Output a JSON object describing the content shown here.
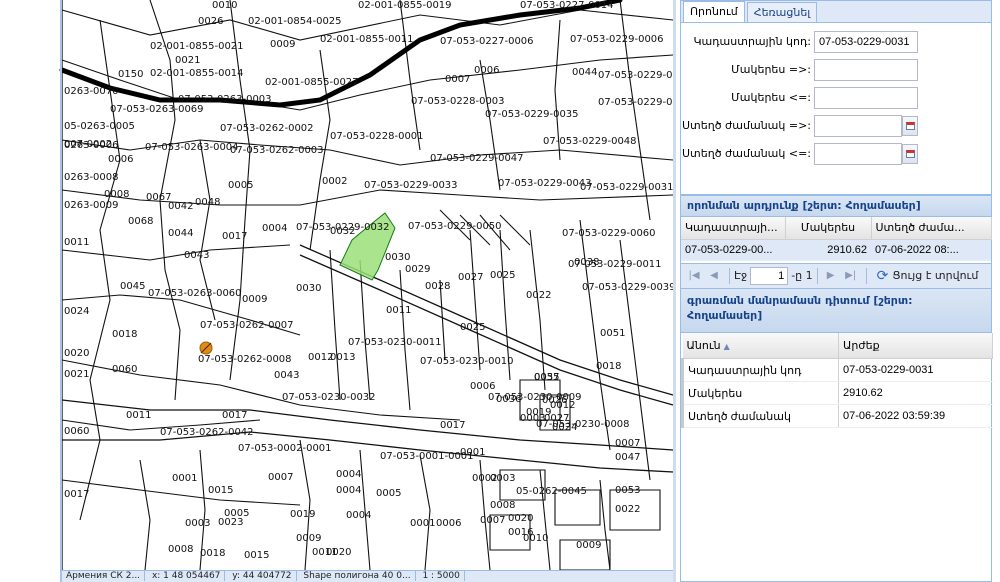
{
  "map": {
    "parcel_labels": [
      {
        "text": "0026"
      },
      {
        "text": "0010"
      },
      {
        "text": "02-001-0854-0025"
      },
      {
        "text": "02-001-0855-0019"
      },
      {
        "text": "07-053-0227-0014"
      },
      {
        "text": "02-001-0855-0021"
      },
      {
        "text": "0009"
      },
      {
        "text": "02-001-0855-0011"
      },
      {
        "text": "07-053-0227-0006"
      },
      {
        "text": "07-053-0229-0006"
      },
      {
        "text": "0021"
      },
      {
        "text": "0044"
      },
      {
        "text": "07-053-0229-0007"
      },
      {
        "text": "0150"
      },
      {
        "text": "02-001-0855-0014"
      },
      {
        "text": "02-001-0855-0027"
      },
      {
        "text": "0007"
      },
      {
        "text": "07-053-0229-0009"
      },
      {
        "text": "0006"
      },
      {
        "text": "0263-0070"
      },
      {
        "text": "07-053-0263-0003"
      },
      {
        "text": "07-053-0228-0003"
      },
      {
        "text": "07-053-0263-0069"
      },
      {
        "text": "07-053-0229-0035"
      },
      {
        "text": "05-0263-0005"
      },
      {
        "text": "07-053-0262-0002"
      },
      {
        "text": "07-053-0228-0001"
      },
      {
        "text": "07-053-0229-0048"
      },
      {
        "text": "007-0002"
      },
      {
        "text": "0263-0006"
      },
      {
        "text": "07-053-0263-0004"
      },
      {
        "text": "07-053-0262-0003"
      },
      {
        "text": "0006"
      },
      {
        "text": "07-053-0229-0047"
      },
      {
        "text": "07-053-0229-0043"
      },
      {
        "text": "0263-0008"
      },
      {
        "text": "0002"
      },
      {
        "text": "07-053-0229-0033"
      },
      {
        "text": "0005"
      },
      {
        "text": "0008"
      },
      {
        "text": "0067"
      },
      {
        "text": "0048"
      },
      {
        "text": "07-053-0229-0031"
      },
      {
        "text": "0263-0009"
      },
      {
        "text": "0068"
      },
      {
        "text": "0042"
      },
      {
        "text": "0004"
      },
      {
        "text": "07-053-0229-0032"
      },
      {
        "text": "07-053-0229-0050"
      },
      {
        "text": "0032"
      },
      {
        "text": "07-053-0229-0060"
      },
      {
        "text": "0011"
      },
      {
        "text": "0044"
      },
      {
        "text": "0017"
      },
      {
        "text": "0043"
      },
      {
        "text": "0030"
      },
      {
        "text": "0029"
      },
      {
        "text": "0027"
      },
      {
        "text": "0025"
      },
      {
        "text": "0038"
      },
      {
        "text": "07-053-0229-0011"
      },
      {
        "text": "0022"
      },
      {
        "text": "07-053-0263-0060"
      },
      {
        "text": "0028"
      },
      {
        "text": "0030"
      },
      {
        "text": "07-053-0229-0039"
      },
      {
        "text": "0045"
      },
      {
        "text": "0009"
      },
      {
        "text": "0011"
      },
      {
        "text": "0024"
      },
      {
        "text": "0018"
      },
      {
        "text": "07-053-0262-0007"
      },
      {
        "text": "0025"
      },
      {
        "text": "0051"
      },
      {
        "text": "07-053-0230-0011"
      },
      {
        "text": "0020"
      },
      {
        "text": "0060"
      },
      {
        "text": "07-053-0262-0008"
      },
      {
        "text": "0013"
      },
      {
        "text": "0012"
      },
      {
        "text": "07-053-0230-0010"
      },
      {
        "text": "0018"
      },
      {
        "text": "0021"
      },
      {
        "text": "0043"
      },
      {
        "text": "0055"
      },
      {
        "text": "0006"
      },
      {
        "text": "07-053-0230-0032"
      },
      {
        "text": "0036"
      },
      {
        "text": "07-053-0230-0009"
      },
      {
        "text": "0011"
      },
      {
        "text": "0017"
      },
      {
        "text": "07-053-0230-0008"
      },
      {
        "text": "07-053-0262-0042"
      },
      {
        "text": "0017"
      },
      {
        "text": "07-053-0002-0001"
      },
      {
        "text": "0007"
      },
      {
        "text": "07-053-0001-0001"
      },
      {
        "text": "0060"
      },
      {
        "text": "0004"
      },
      {
        "text": "0003"
      },
      {
        "text": "0001"
      },
      {
        "text": "0001"
      },
      {
        "text": "0002"
      },
      {
        "text": "0004"
      },
      {
        "text": "0015"
      },
      {
        "text": "0007"
      },
      {
        "text": "0005"
      },
      {
        "text": "05-0262-0045"
      },
      {
        "text": "0017"
      },
      {
        "text": "0005"
      },
      {
        "text": "0008"
      },
      {
        "text": "0023"
      },
      {
        "text": "0019"
      },
      {
        "text": "0003"
      },
      {
        "text": "0008"
      },
      {
        "text": "0004"
      },
      {
        "text": "0001"
      },
      {
        "text": "0006"
      },
      {
        "text": "0007"
      },
      {
        "text": "0020"
      },
      {
        "text": "0016"
      },
      {
        "text": "0010"
      },
      {
        "text": "0009"
      },
      {
        "text": "0011"
      },
      {
        "text": "0020"
      },
      {
        "text": "0018"
      },
      {
        "text": "0015"
      },
      {
        "text": "0009"
      },
      {
        "text": "0022"
      },
      {
        "text": "0053"
      },
      {
        "text": "0047"
      },
      {
        "text": "0037"
      },
      {
        "text": "0012"
      },
      {
        "text": "0026"
      },
      {
        "text": "0019"
      },
      {
        "text": "0027"
      },
      {
        "text": "0003"
      },
      {
        "text": "0024"
      }
    ],
    "selected_parcel_color": "#9be07a",
    "status_bar": [
      "Армения СК 2...",
      "x: 1 48 054467",
      "y: 44 404772",
      "Shape полигона 40 0...",
      "1 : 5000"
    ]
  },
  "panel": {
    "tabs": [
      {
        "label": "Որոնում",
        "active": true
      },
      {
        "label": "Հեռացնել",
        "active": false
      }
    ],
    "search": {
      "cadastral_code_label": "Կադաստրային կոդ:",
      "cadastral_code_value": "07-053-0229-0031",
      "area_min_label": "Մակերես =>:",
      "area_min_value": "",
      "area_max_label": "Մակերես <=:",
      "area_max_value": "",
      "created_from_label": "Ստեղծ ժամանակ =>:",
      "created_from_value": "",
      "created_to_label": "Ստեղծ ժամանակ <=:",
      "created_to_value": ""
    },
    "results": {
      "title": "որոնման արդյունք [շերտ: Հողամասեր]",
      "columns": [
        "Կադաստրայի...",
        "Մակերես",
        "Ստեղծ ժամա..."
      ],
      "rows": [
        {
          "code": "07-053-0229-00...",
          "area": "2910.62",
          "created": "07-06-2022 08:..."
        }
      ]
    },
    "pager": {
      "page_label": "Էջ",
      "page_value": "1",
      "of_label": "-ը 1",
      "refresh_label": "Ցույց է տրվում"
    },
    "details": {
      "title": "գրառման մանրամասն դիտում [շերտ: Հողամասեր]",
      "col_name": "Անուն",
      "col_value": "Արժեք",
      "rows": [
        {
          "name": "Կադաստրային կոդ",
          "value": "07-053-0229-0031"
        },
        {
          "name": "Մակերես",
          "value": "2910.62"
        },
        {
          "name": "Ստեղծ ժամանակ",
          "value": "07-06-2022 03:59:39"
        }
      ]
    }
  }
}
